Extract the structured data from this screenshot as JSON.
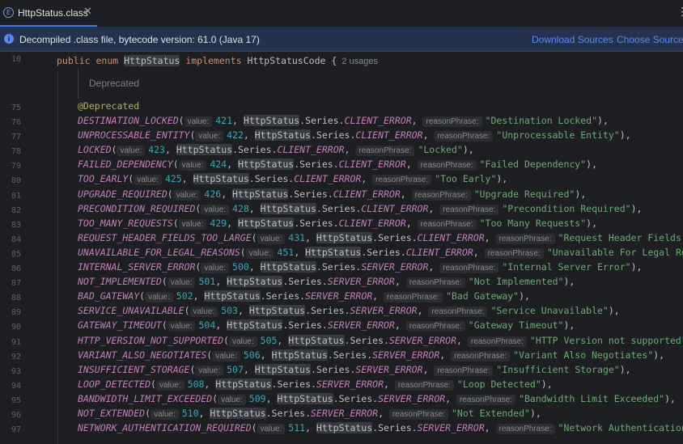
{
  "tab": {
    "title": "HttpStatus.class",
    "icon_letter": "E",
    "close_glyph": "✕",
    "more_glyph": "⋮"
  },
  "banner": {
    "icon_glyph": "i",
    "message": "Decompiled .class file, bytecode version: 61.0 (Java 17)",
    "download_sources": "Download Sources",
    "choose_sources": "Choose Sources..."
  },
  "editor": {
    "header_line_number": "10",
    "header": {
      "kw_public": "public",
      "kw_enum": "enum",
      "class_name": "HttpStatus",
      "kw_implements": "implements",
      "interface_name": "HttpStatusCode",
      "brace": "{",
      "usages": "2 usages"
    },
    "deprecated_doc": "Deprecated",
    "annotation_line_number": "75",
    "annotation": "@Deprecated",
    "hint_value": "value:",
    "hint_reason": "reasonPhrase:",
    "class_ref": "HttpStatus",
    "series_ref": ".Series.",
    "lines": [
      {
        "ln": "76",
        "name": "DESTINATION_LOCKED",
        "value": "421",
        "series": "CLIENT_ERROR",
        "reason": "\"Destination Locked\"",
        "end": "),"
      },
      {
        "ln": "77",
        "name": "UNPROCESSABLE_ENTITY",
        "value": "422",
        "series": "CLIENT_ERROR",
        "reason": "\"Unprocessable Entity\"",
        "end": "),"
      },
      {
        "ln": "78",
        "name": "LOCKED",
        "value": "423",
        "series": "CLIENT_ERROR",
        "reason": "\"Locked\"",
        "end": "),"
      },
      {
        "ln": "79",
        "name": "FAILED_DEPENDENCY",
        "value": "424",
        "series": "CLIENT_ERROR",
        "reason": "\"Failed Dependency\"",
        "end": "),"
      },
      {
        "ln": "80",
        "name": "TOO_EARLY",
        "value": "425",
        "series": "CLIENT_ERROR",
        "reason": "\"Too Early\"",
        "end": "),"
      },
      {
        "ln": "81",
        "name": "UPGRADE_REQUIRED",
        "value": "426",
        "series": "CLIENT_ERROR",
        "reason": "\"Upgrade Required\"",
        "end": "),"
      },
      {
        "ln": "82",
        "name": "PRECONDITION_REQUIRED",
        "value": "428",
        "series": "CLIENT_ERROR",
        "reason": "\"Precondition Required\"",
        "end": "),"
      },
      {
        "ln": "83",
        "name": "TOO_MANY_REQUESTS",
        "value": "429",
        "series": "CLIENT_ERROR",
        "reason": "\"Too Many Requests\"",
        "end": "),"
      },
      {
        "ln": "84",
        "name": "REQUEST_HEADER_FIELDS_TOO_LARGE",
        "value": "431",
        "series": "CLIENT_ERROR",
        "reason": "\"Request Header Fields Too",
        "end": ""
      },
      {
        "ln": "85",
        "name": "UNAVAILABLE_FOR_LEGAL_REASONS",
        "value": "451",
        "series": "CLIENT_ERROR",
        "reason": "\"Unavailable For Legal Reason",
        "end": ""
      },
      {
        "ln": "86",
        "name": "INTERNAL_SERVER_ERROR",
        "value": "500",
        "series": "SERVER_ERROR",
        "reason": "\"Internal Server Error\"",
        "end": "),"
      },
      {
        "ln": "87",
        "name": "NOT_IMPLEMENTED",
        "value": "501",
        "series": "SERVER_ERROR",
        "reason": "\"Not Implemented\"",
        "end": "),"
      },
      {
        "ln": "88",
        "name": "BAD_GATEWAY",
        "value": "502",
        "series": "SERVER_ERROR",
        "reason": "\"Bad Gateway\"",
        "end": "),"
      },
      {
        "ln": "89",
        "name": "SERVICE_UNAVAILABLE",
        "value": "503",
        "series": "SERVER_ERROR",
        "reason": "\"Service Unavailable\"",
        "end": "),"
      },
      {
        "ln": "90",
        "name": "GATEWAY_TIMEOUT",
        "value": "504",
        "series": "SERVER_ERROR",
        "reason": "\"Gateway Timeout\"",
        "end": "),"
      },
      {
        "ln": "91",
        "name": "HTTP_VERSION_NOT_SUPPORTED",
        "value": "505",
        "series": "SERVER_ERROR",
        "reason": "\"HTTP Version not supported\"",
        "end": "),"
      },
      {
        "ln": "92",
        "name": "VARIANT_ALSO_NEGOTIATES",
        "value": "506",
        "series": "SERVER_ERROR",
        "reason": "\"Variant Also Negotiates\"",
        "end": "),"
      },
      {
        "ln": "93",
        "name": "INSUFFICIENT_STORAGE",
        "value": "507",
        "series": "SERVER_ERROR",
        "reason": "\"Insufficient Storage\"",
        "end": "),"
      },
      {
        "ln": "94",
        "name": "LOOP_DETECTED",
        "value": "508",
        "series": "SERVER_ERROR",
        "reason": "\"Loop Detected\"",
        "end": "),"
      },
      {
        "ln": "95",
        "name": "BANDWIDTH_LIMIT_EXCEEDED",
        "value": "509",
        "series": "SERVER_ERROR",
        "reason": "\"Bandwidth Limit Exceeded\"",
        "end": "),"
      },
      {
        "ln": "96",
        "name": "NOT_EXTENDED",
        "value": "510",
        "series": "SERVER_ERROR",
        "reason": "\"Not Extended\"",
        "end": "),"
      },
      {
        "ln": "97",
        "name": "NETWORK_AUTHENTICATION_REQUIRED",
        "value": "511",
        "series": "SERVER_ERROR",
        "reason": "\"Network Authentication Rec",
        "end": ""
      }
    ]
  },
  "colors": {
    "background": "#1e1f22",
    "banner_bg": "#25324d",
    "link": "#548af7",
    "keyword": "#cf8e6d",
    "enum_constant": "#c77dbb",
    "number": "#2aacb8",
    "string": "#6aab73",
    "annotation": "#b3ae60"
  }
}
